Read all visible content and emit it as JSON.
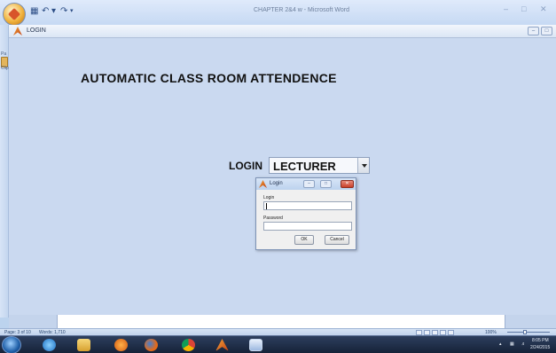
{
  "word": {
    "title": "CHAPTER 2&4 w - Microsoft Word",
    "ribbon_label_1": "Pa",
    "ribbon_label_2": "Clip",
    "status": {
      "page": "Page: 3 of 10",
      "words": "Words: 1,710",
      "zoom": "100%"
    }
  },
  "figure": {
    "title": "LOGIN",
    "heading": "AUTOMATIC CLASS ROOM ATTENDENCE",
    "login_label": "LOGIN",
    "role_selected": "LECTURER"
  },
  "dialog": {
    "title": "Login",
    "login_label": "Login",
    "login_value": "",
    "password_label": "Password",
    "password_value": "",
    "ok_label": "OK",
    "cancel_label": "Cancel"
  },
  "taskbar": {
    "time": "8:05 PM",
    "date": "2/24/2015",
    "icons": [
      "windows-start-icon",
      "internet-explorer-icon",
      "folder-icon",
      "media-player-icon",
      "firefox-icon",
      "chrome-icon",
      "matlab-icon",
      "word-icon"
    ]
  }
}
